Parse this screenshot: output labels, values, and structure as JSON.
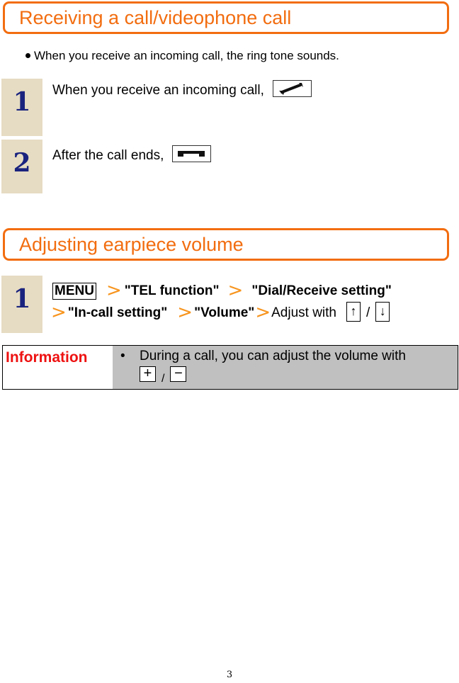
{
  "sections": [
    {
      "title": "Receiving a call/videophone call",
      "intro_bullet": "When you receive an incoming call, the ring tone sounds.",
      "steps": [
        {
          "number": "1",
          "text": "When you receive an incoming call,",
          "key_icon": "off-hook-phone-icon"
        },
        {
          "number": "2",
          "text": "After the call ends,",
          "key_icon": "on-hook-phone-icon"
        }
      ]
    },
    {
      "title": "Adjusting earpiece volume",
      "steps": [
        {
          "number": "1",
          "menu_key": "MENU",
          "path": [
            "\"TEL  function\"",
            "\"Dial/Receive  setting\"",
            "\"In-call setting\"",
            "\"Volume\""
          ],
          "tail_text": "Adjust with",
          "keys": [
            "↑",
            "↓"
          ],
          "separator": "/"
        }
      ]
    }
  ],
  "arrow_glyph": ">",
  "information": {
    "label": "Information",
    "bullet": "•",
    "text": "During a call, you can adjust the volume with",
    "keys": [
      "+",
      "−"
    ],
    "separator": "/"
  },
  "page_number": "3",
  "colors": {
    "accent_orange": "#f26d10",
    "arrow_orange": "#f7941d",
    "step_badge_bg": "#e6dcc3",
    "step_number": "#1a237e",
    "info_label": "#ee1111",
    "info_bg": "#c0c0c0"
  }
}
